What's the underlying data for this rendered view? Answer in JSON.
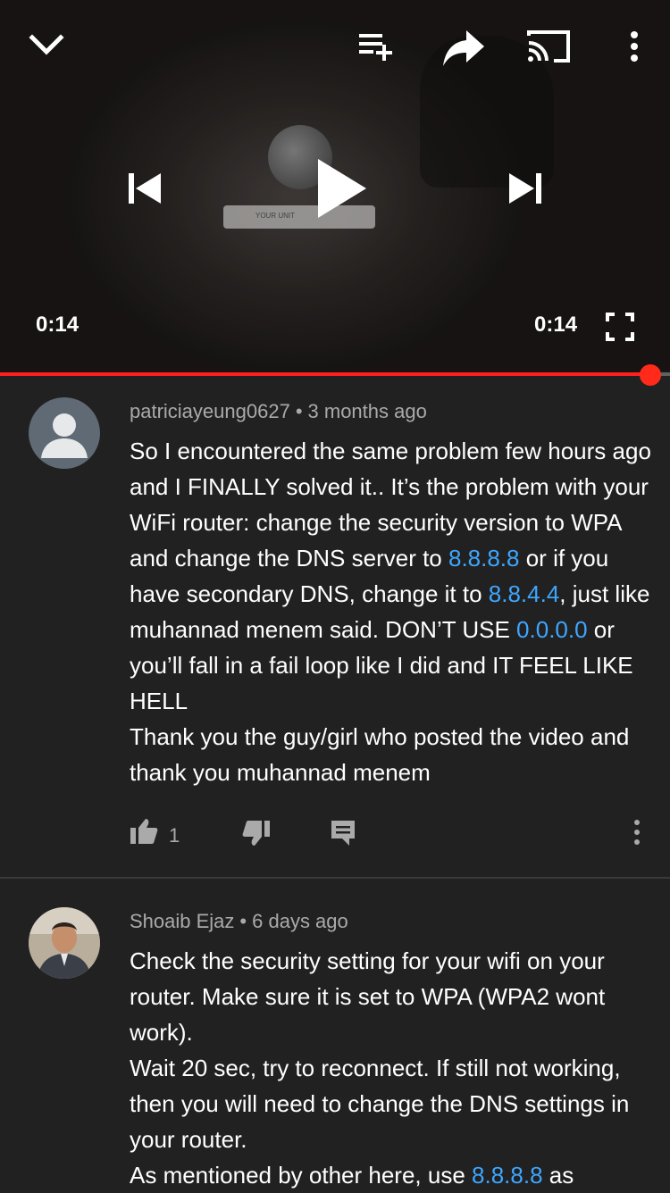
{
  "player": {
    "current_time": "0:14",
    "duration": "0:14",
    "progress": 0.97,
    "controls": {
      "collapse": "chevron-down-icon",
      "add_to_playlist": "playlist-add-icon",
      "share": "share-icon",
      "cast": "cast-icon",
      "more": "more-vertical-icon",
      "previous": "skip-previous-icon",
      "play": "play-icon",
      "next": "skip-next-icon",
      "fullscreen": "fullscreen-icon"
    },
    "accent_color": "#ff2a1a"
  },
  "comments": [
    {
      "author": "patriciayeung0627",
      "time": "3 months ago",
      "body": [
        {
          "text": "So I encountered the same problem few hours ago and I FINALLY solved it.. It’s the problem with your WiFi router: change the security version to WPA and change the DNS server to "
        },
        {
          "text": "8.8.8.8",
          "link": true
        },
        {
          "text": " or if you have secondary DNS, change it to "
        },
        {
          "text": "8.8.4.4",
          "link": true
        },
        {
          "text": ", just like muhannad menem said. DON’T USE "
        },
        {
          "text": "0.0.0.0",
          "link": true
        },
        {
          "text": " or you’ll fall in a fail loop like I did and IT FEEL LIKE HELL"
        },
        {
          "break": true
        },
        {
          "text": "Thank you the guy/girl who posted the video and thank you muhannad menem"
        }
      ],
      "likes": "1"
    },
    {
      "author": "Shoaib Ejaz",
      "time": "6 days ago",
      "body": [
        {
          "text": "Check the security setting for your wifi on your router. Make sure it is set to WPA (WPA2 wont work)."
        },
        {
          "break": true
        },
        {
          "text": "Wait 20 sec, try to reconnect. If still not working, then you will need to change the DNS settings in your router."
        },
        {
          "break": true
        },
        {
          "text": "As mentioned by other here, use "
        },
        {
          "text": "8.8.8.8",
          "link": true
        },
        {
          "text": " as"
        }
      ]
    }
  ],
  "colors": {
    "background": "#212121",
    "link": "#3ea6ff",
    "meta_text": "#aaaaaa"
  }
}
